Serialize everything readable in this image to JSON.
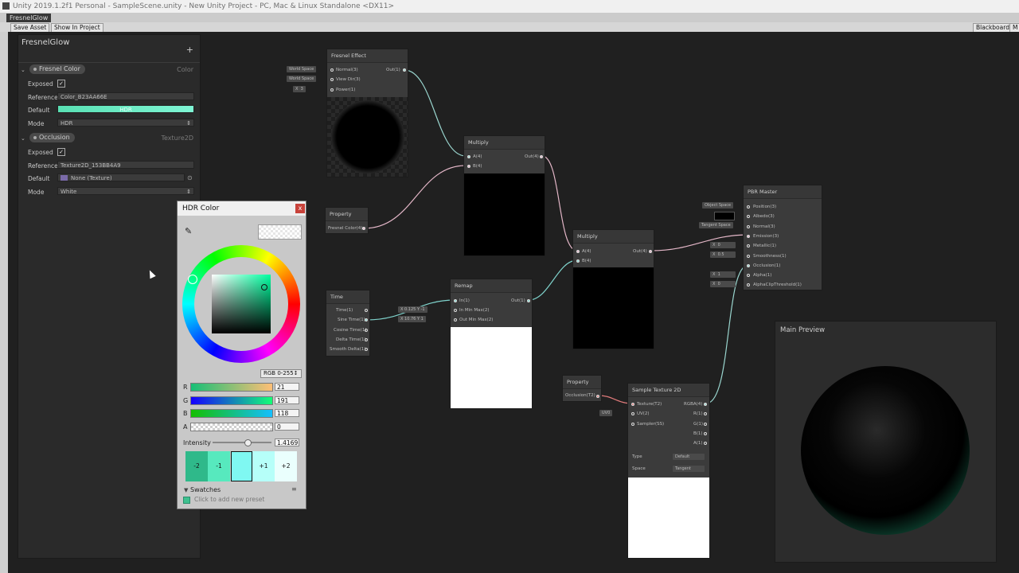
{
  "window": {
    "title": "Unity 2019.1.2f1 Personal - SampleScene.unity - New Unity Project - PC, Mac & Linux Standalone <DX11>"
  },
  "tab": {
    "label": "FresnelGlow"
  },
  "toolbar": {
    "save_asset": "Save Asset",
    "show_in_project": "Show In Project",
    "blackboard": "Blackboard",
    "main_preview_short": "M"
  },
  "blackboard": {
    "title": "FresnelGlow",
    "add": "+",
    "properties": [
      {
        "name": "Fresnel Color",
        "type": "Color",
        "exposed_label": "Exposed",
        "reference_label": "Reference",
        "reference": "Color_B23AA66E",
        "default_label": "Default",
        "default_text": "HDR",
        "mode_label": "Mode",
        "mode": "HDR"
      },
      {
        "name": "Occlusion",
        "type": "Texture2D",
        "exposed_label": "Exposed",
        "reference_label": "Reference",
        "reference": "Texture2D_153BB4A9",
        "default_label": "Default",
        "default_text": "None (Texture)",
        "mode_label": "Mode",
        "mode": "White"
      }
    ]
  },
  "hdr_color": {
    "title": "HDR Color",
    "mode_button": "RGB 0-255↕",
    "channels": [
      {
        "label": "R",
        "value": "21"
      },
      {
        "label": "G",
        "value": "191"
      },
      {
        "label": "B",
        "value": "118"
      },
      {
        "label": "A",
        "value": "0"
      }
    ],
    "intensity_label": "Intensity",
    "intensity_value": "1.4169",
    "swatches": [
      "-2",
      "-1",
      "",
      "+1",
      "+2"
    ],
    "swatches_label": "Swatches",
    "add_preset": "Click to add new preset",
    "color_hex": "#15bf76"
  },
  "nodes": {
    "fresnel": {
      "title": "Fresnel Effect",
      "inputs": [
        "Normal(3)",
        "View Dir(3)",
        "Power(1)"
      ],
      "output": "Out(1)",
      "in_normal": "World Space",
      "in_view": "World Space",
      "in_power_x": "X",
      "in_power_val": "3"
    },
    "multiply1": {
      "title": "Multiply",
      "inputs": [
        "A(4)",
        "B(4)"
      ],
      "output": "Out(4)"
    },
    "property1": {
      "title": "Property",
      "output": "Fresnel Color(4)"
    },
    "time": {
      "title": "Time",
      "outputs": [
        "Time(1)",
        "Sine Time(1)",
        "Cosine Time(1)",
        "Delta Time(1)",
        "Smooth Delta(1)"
      ]
    },
    "remap": {
      "title": "Remap",
      "inputs": [
        "In(1)",
        "In Min Max(2)",
        "Out Min Max(2)"
      ],
      "output": "Out(1)",
      "inminmax": [
        "X",
        "0.125",
        "Y",
        "-1"
      ],
      "outminmax": [
        "X",
        "10.76",
        "Y",
        "1"
      ]
    },
    "multiply2": {
      "title": "Multiply",
      "inputs": [
        "A(4)",
        "B(4)"
      ],
      "output": "Out(4)"
    },
    "property2": {
      "title": "Property",
      "output": "Occlusion(T2)"
    },
    "sample": {
      "title": "Sample Texture 2D",
      "inputs": [
        "Texture(T2)",
        "UV(2)",
        "Sampler(SS)"
      ],
      "outputs": [
        "RGBA(4)",
        "R(1)",
        "G(1)",
        "B(1)",
        "A(1)"
      ],
      "uv_in": "UV0",
      "type_label": "Type",
      "type": "Default",
      "space_label": "Space",
      "space": "Tangent"
    },
    "pbr": {
      "title": "PBR Master",
      "inputs": [
        "Position(3)",
        "Albedo(3)",
        "Normal(3)",
        "Emission(3)",
        "Metallic(1)",
        "Smoothness(1)",
        "Occlusion(1)",
        "Alpha(1)",
        "AlphaClipThreshold(1)"
      ],
      "pos_space": "Object Space",
      "normal_space": "Tangent Space",
      "metallic": [
        "X",
        "0"
      ],
      "smooth": [
        "X",
        "0.5"
      ],
      "alpha": [
        "X",
        "1"
      ],
      "clip": [
        "X",
        "0"
      ]
    }
  },
  "preview": {
    "title": "Main Preview"
  }
}
